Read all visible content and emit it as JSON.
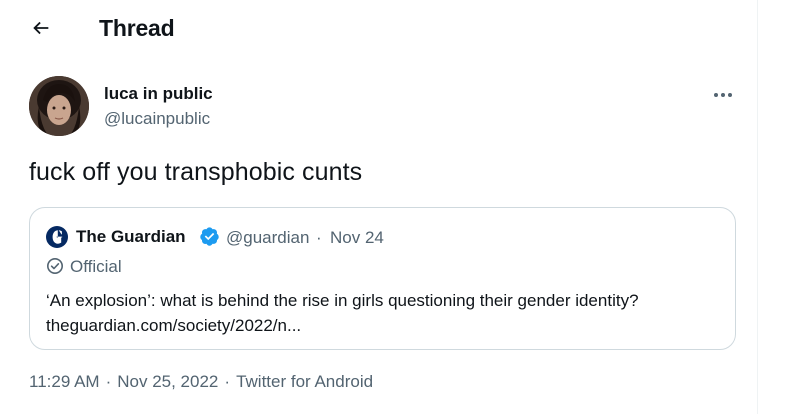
{
  "header": {
    "title": "Thread",
    "back_icon": "arrow-left-icon"
  },
  "author": {
    "name": "luca in public",
    "handle": "@lucainpublic",
    "avatar_icon": "avatar"
  },
  "tweet": {
    "text": "fuck off you transphobic cunts",
    "time": "11:29 AM",
    "date": "Nov 25, 2022",
    "source": "Twitter for Android",
    "separator": "·"
  },
  "quoted_tweet": {
    "name": "The Guardian",
    "handle": "@guardian",
    "separator": "·",
    "date": "Nov 24",
    "label": "Official",
    "text_line1": "‘An explosion’: what is behind the rise in girls questioning their gender identity?",
    "text_line2": "theguardian.com/society/2022/n..."
  },
  "colors": {
    "text": "#0f1419",
    "secondary": "#536471",
    "border": "#cfd9de",
    "verified": "#1d9bf0",
    "guardian_logo": "#052962"
  }
}
